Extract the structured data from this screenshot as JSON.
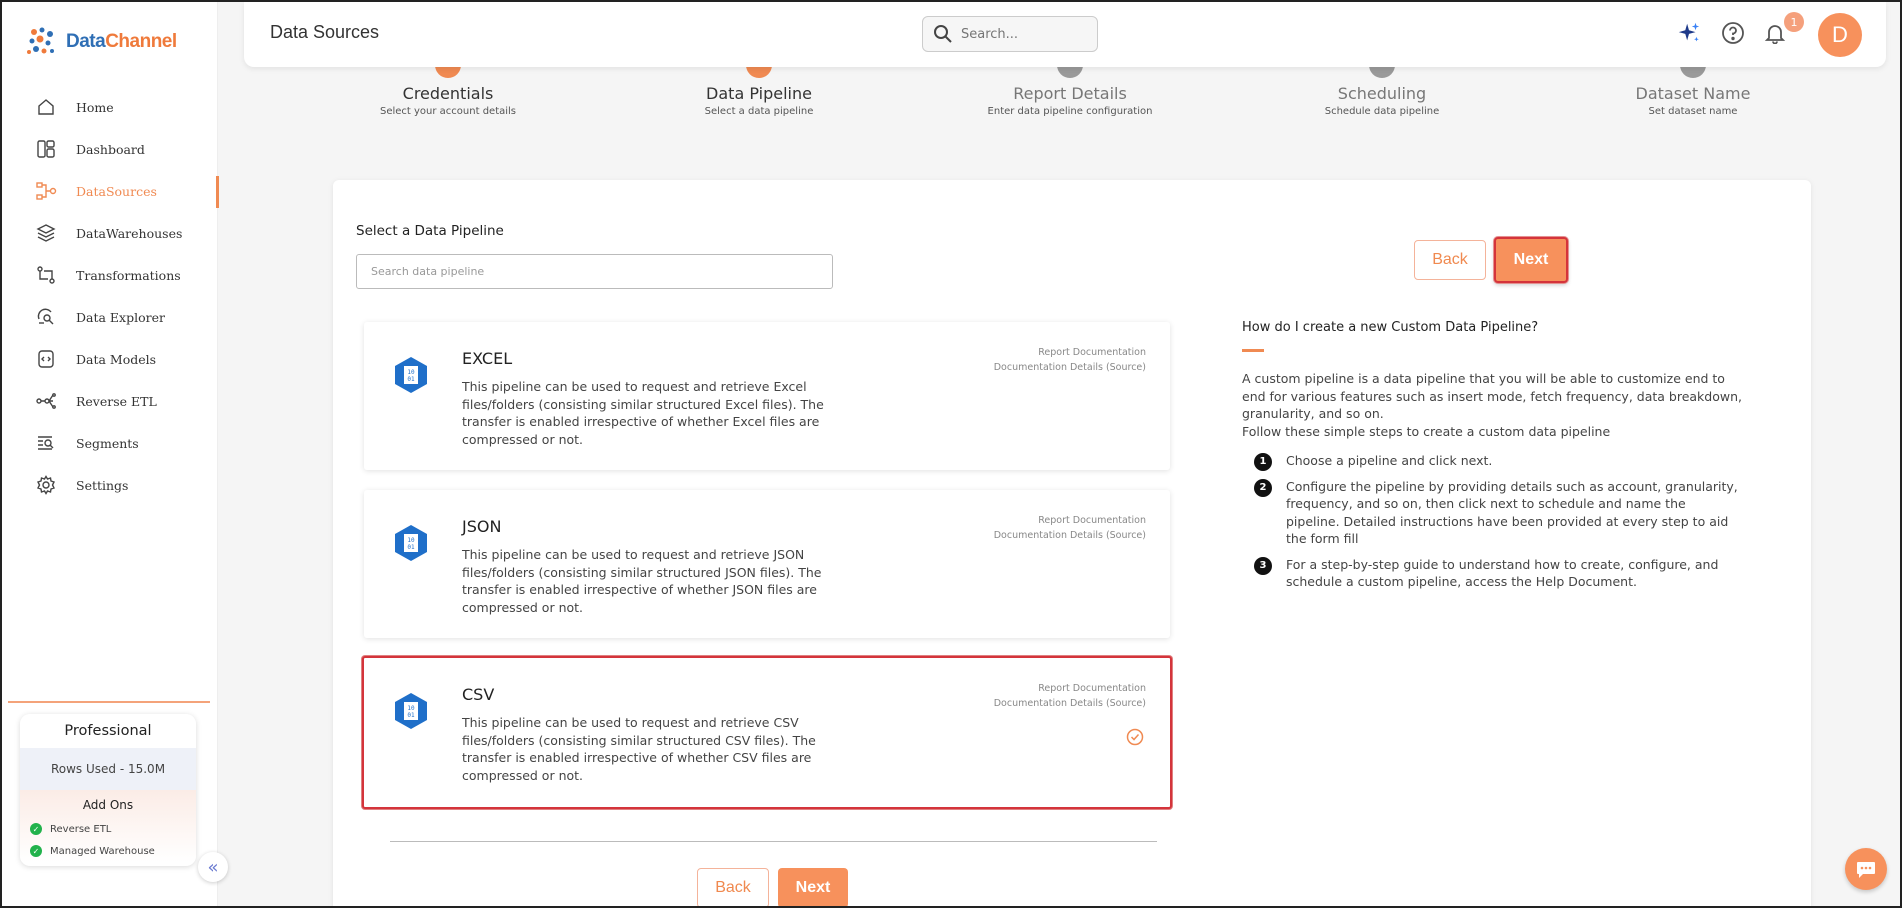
{
  "app": {
    "logo_part1": "Data",
    "logo_part2": "Channel"
  },
  "sidebar": {
    "items": [
      {
        "label": "Home",
        "icon": "home-icon"
      },
      {
        "label": "Dashboard",
        "icon": "dashboard-icon"
      },
      {
        "label": "DataSources",
        "icon": "datasources-icon",
        "active": true
      },
      {
        "label": "DataWarehouses",
        "icon": "layers-icon"
      },
      {
        "label": "Transformations",
        "icon": "transformations-icon"
      },
      {
        "label": "Data Explorer",
        "icon": "data-explorer-icon"
      },
      {
        "label": "Data Models",
        "icon": "data-models-icon"
      },
      {
        "label": "Reverse ETL",
        "icon": "reverse-etl-icon"
      },
      {
        "label": "Segments",
        "icon": "segments-icon"
      },
      {
        "label": "Settings",
        "icon": "gear-icon"
      }
    ],
    "plan": {
      "name": "Professional",
      "rows_used": "Rows Used - 15.0M",
      "addons_title": "Add Ons",
      "addons": [
        "Reverse ETL",
        "Managed Warehouse"
      ]
    }
  },
  "header": {
    "title": "Data Sources",
    "search_placeholder": "Search...",
    "notification_count": "1",
    "avatar_letter": "D"
  },
  "stepper": {
    "steps": [
      {
        "name": "Credentials",
        "sub": "Select your account details",
        "state": "done"
      },
      {
        "name": "Data Pipeline",
        "sub": "Select a data pipeline",
        "state": "active"
      },
      {
        "name": "Report Details",
        "sub": "Enter data pipeline configuration",
        "state": "pending"
      },
      {
        "name": "Scheduling",
        "sub": "Schedule data pipeline",
        "state": "pending"
      },
      {
        "name": "Dataset Name",
        "sub": "Set dataset name",
        "state": "pending"
      }
    ]
  },
  "main": {
    "select_title": "Select a Data Pipeline",
    "search_placeholder": "Search data pipeline",
    "back_label": "Back",
    "next_label": "Next",
    "pipelines": [
      {
        "title": "EXCEL",
        "desc": "This pipeline can be used to request and retrieve Excel files/folders (consisting similar structured Excel files). The transfer is enabled irrespective of whether Excel files are compressed or not.",
        "link1": "Report Documentation",
        "link2": "Documentation Details (Source)",
        "selected": false
      },
      {
        "title": "JSON",
        "desc": "This pipeline can be used to request and retrieve JSON files/folders (consisting similar structured JSON files). The transfer is enabled irrespective of whether JSON files are compressed or not.",
        "link1": "Report Documentation",
        "link2": "Documentation Details (Source)",
        "selected": false
      },
      {
        "title": "CSV",
        "desc": "This pipeline can be used to request and retrieve CSV files/folders (consisting similar structured CSV files). The transfer is enabled irrespective of whether CSV files are compressed or not.",
        "link1": "Report Documentation",
        "link2": "Documentation Details (Source)",
        "selected": true
      }
    ]
  },
  "help": {
    "title": "How do I create a new Custom Data Pipeline?",
    "intro1": "A custom pipeline is a data pipeline that you will be able to customize end to end for various features such as insert mode, fetch frequency, data breakdown, granularity, and so on.",
    "intro2": "Follow these simple steps to create a custom data pipeline",
    "steps": [
      {
        "num": "1",
        "text": "Choose a pipeline and click next."
      },
      {
        "num": "2",
        "text": "Configure the pipeline by providing details such as account, granularity, frequency, and so on, then click next to schedule and name the pipeline. Detailed instructions have been provided at every step to aid the form fill"
      },
      {
        "num": "3",
        "text": "For a step-by-step guide to understand how to create, configure, and schedule a custom pipeline, access the Help Document."
      }
    ]
  },
  "colors": {
    "accent": "#f7915c",
    "step_done": "#f08a52",
    "step_pending": "#9a9a9a",
    "highlight": "#d4343b",
    "pipeline_icon": "#1f6fc9"
  }
}
